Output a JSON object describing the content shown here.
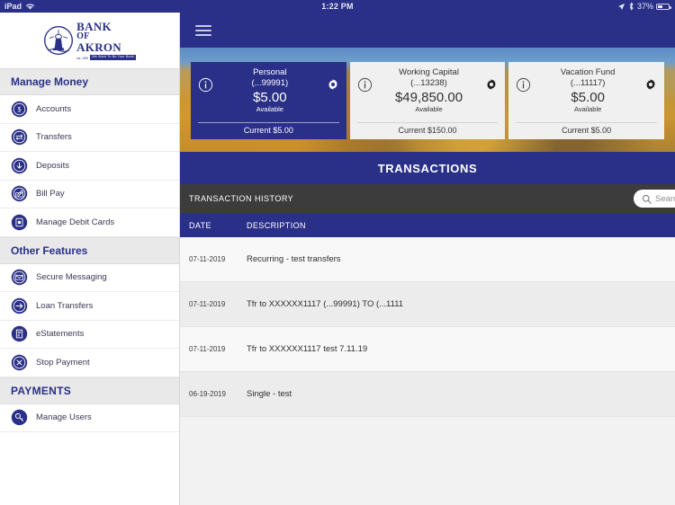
{
  "status_bar": {
    "device": "iPad",
    "wifi_icon": "wifi-icon",
    "time": "1:22 PM",
    "location_icon": "location-arrow-icon",
    "bluetooth_icon": "bluetooth-icon",
    "battery_percent": "37%",
    "battery_icon": "battery-icon"
  },
  "sidebar": {
    "logo": {
      "line1": "BANK",
      "line2": "OF",
      "line3": "AKRON",
      "tagline": "We Want To Be Your Bank",
      "established": "est. 1900",
      "mark_icon": "lighthouse-emblem-icon"
    },
    "sections": [
      {
        "title": "Manage Money",
        "items": [
          {
            "label": "Accounts",
            "icon": "dollar-circle-icon"
          },
          {
            "label": "Transfers",
            "icon": "transfer-arrows-icon"
          },
          {
            "label": "Deposits",
            "icon": "arrow-down-circle-icon"
          },
          {
            "label": "Bill Pay",
            "icon": "check-pen-icon"
          },
          {
            "label": "Manage Debit Cards",
            "icon": "debit-card-icon"
          }
        ]
      },
      {
        "title": "Other Features",
        "items": [
          {
            "label": "Secure Messaging",
            "icon": "envelope-icon"
          },
          {
            "label": "Loan Transfers",
            "icon": "arrow-right-circle-icon"
          },
          {
            "label": "eStatements",
            "icon": "document-icon"
          },
          {
            "label": "Stop Payment",
            "icon": "x-circle-icon"
          }
        ]
      },
      {
        "title": "PAYMENTS",
        "items": [
          {
            "label": "Manage Users",
            "icon": "key-icon"
          }
        ]
      }
    ]
  },
  "main": {
    "menu_icon": "hamburger-menu-icon",
    "accounts": [
      {
        "name": "Personal",
        "number": "(...99991)",
        "balance": "$5.00",
        "available_label": "Available",
        "current": "Current $5.00",
        "selected": true,
        "info_icon": "info-circle-icon",
        "gear_icon": "gear-icon"
      },
      {
        "name": "Working Capital",
        "number": "(...13238)",
        "balance": "$49,850.00",
        "available_label": "Available",
        "current": "Current $150.00",
        "selected": false,
        "info_icon": "info-circle-icon",
        "gear_icon": "gear-icon"
      },
      {
        "name": "Vacation Fund",
        "number": "(...11117)",
        "balance": "$5.00",
        "available_label": "Available",
        "current": "Current $5.00",
        "selected": false,
        "info_icon": "info-circle-icon",
        "gear_icon": "gear-icon"
      }
    ],
    "transactions_title": "TRANSACTIONS",
    "history_label": "TRANSACTION HISTORY",
    "search": {
      "placeholder": "Search",
      "value": "",
      "icon": "search-icon"
    },
    "table": {
      "columns": [
        "DATE",
        "DESCRIPTION"
      ],
      "rows": [
        {
          "date": "07-11-2019",
          "description": "Recurring - test transfers"
        },
        {
          "date": "07-11-2019",
          "description": "Tfr to XXXXXX1117 (...99991) TO (...1111"
        },
        {
          "date": "07-11-2019",
          "description": "Tfr to XXXXXX1117 test 7.11.19"
        },
        {
          "date": "06-19-2019",
          "description": "Single - test"
        }
      ]
    }
  },
  "colors": {
    "brand_blue": "#2A3087",
    "dark_gray_bar": "#3C3C3C",
    "section_header_bg": "#E9E9E9",
    "row_odd": "#F8F8F8",
    "row_even": "#ECECEC"
  }
}
